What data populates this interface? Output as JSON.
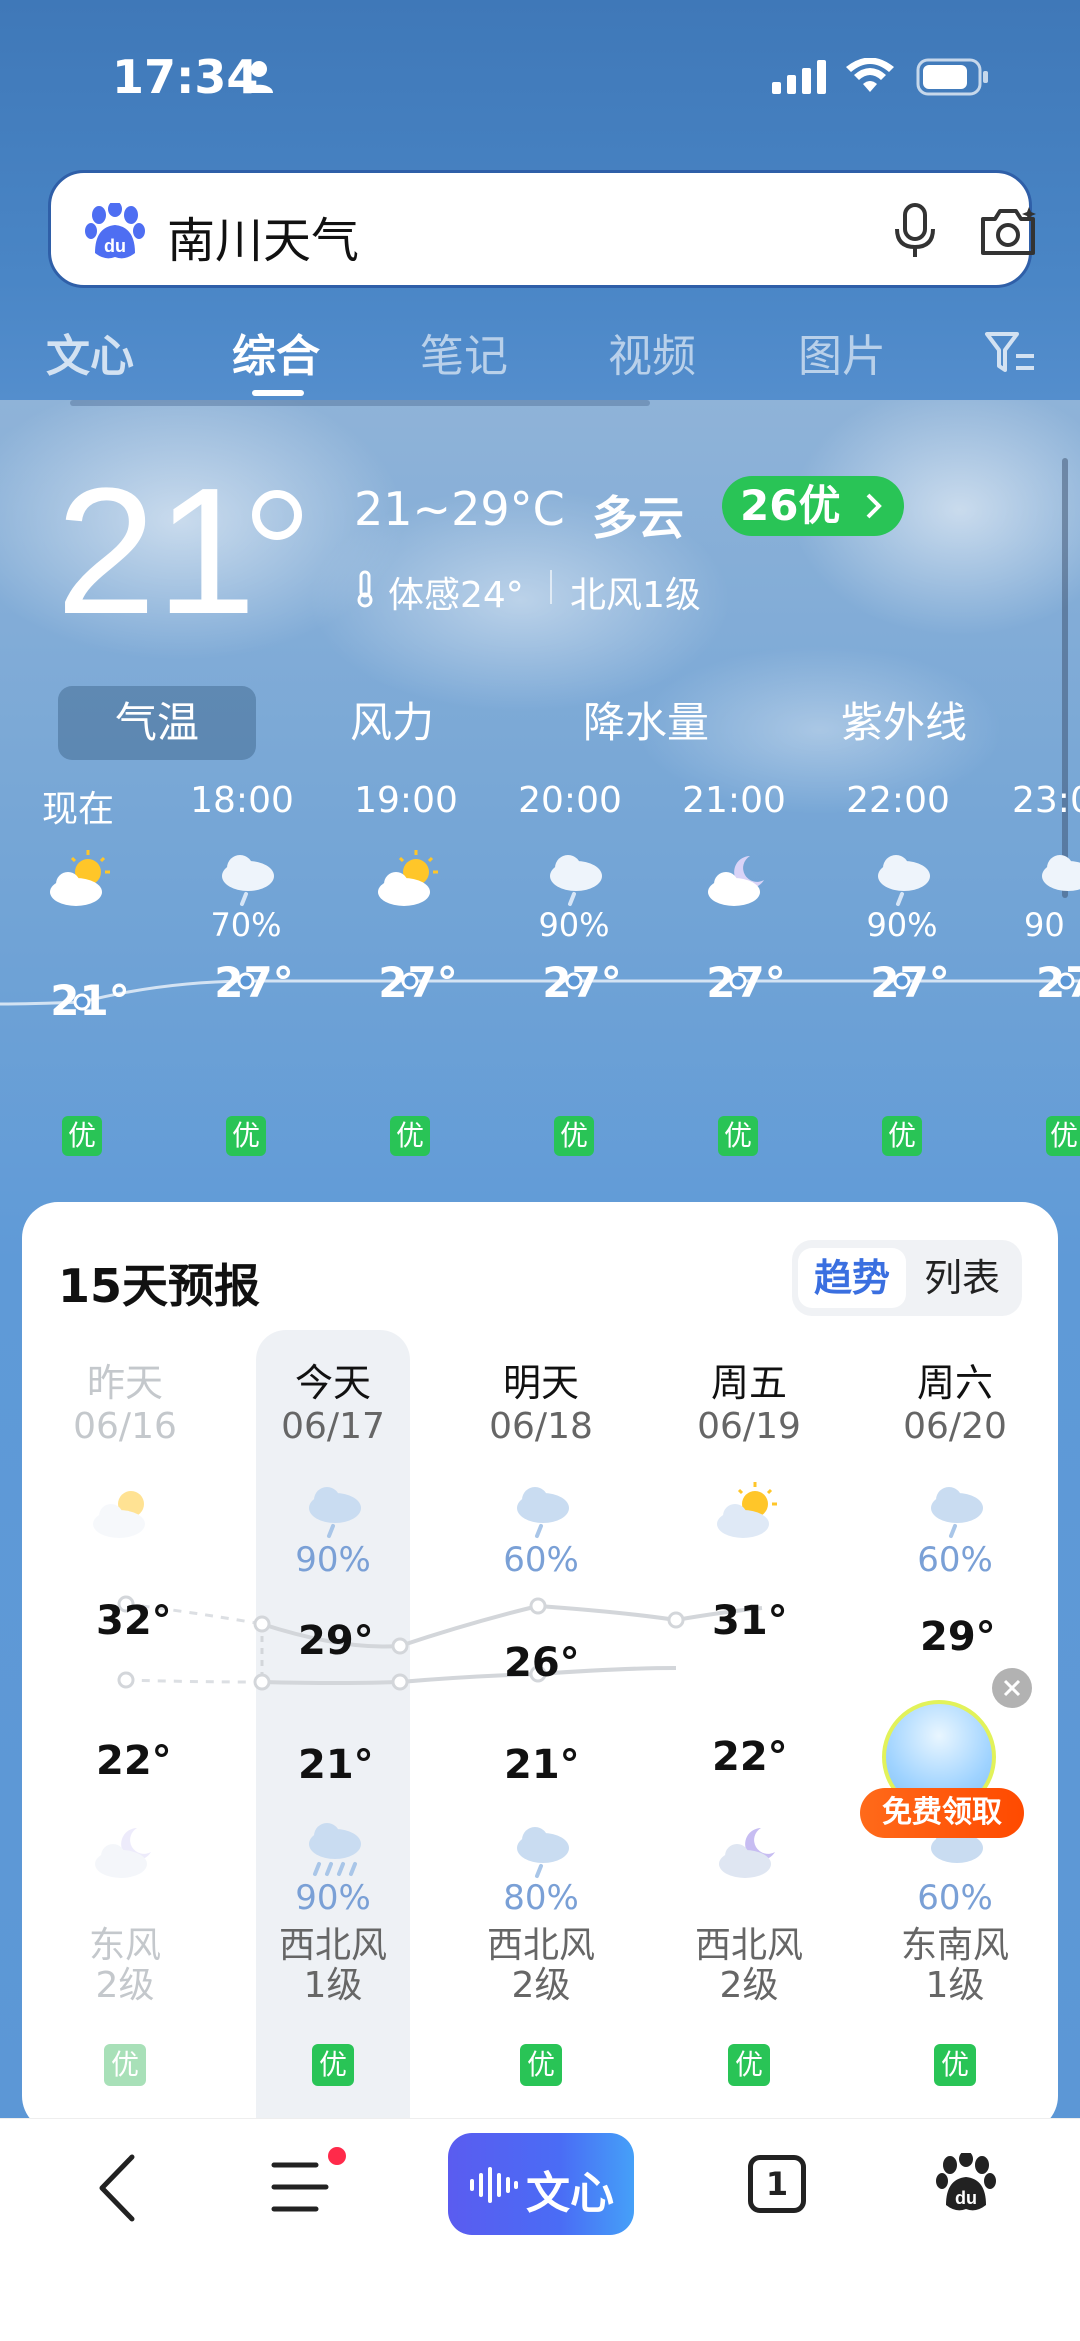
{
  "status_bar": {
    "time": "17:34"
  },
  "search": {
    "query": "南川天气"
  },
  "tabs": [
    {
      "label": "文心"
    },
    {
      "label": "综合"
    },
    {
      "label": "笔记"
    },
    {
      "label": "视频"
    },
    {
      "label": "图片"
    }
  ],
  "current": {
    "temp": "21",
    "range": "21~29°C",
    "condition": "多云",
    "aqi": "26优",
    "feels_like": "体感24°",
    "wind": "北风1级"
  },
  "segments": [
    {
      "label": "气温"
    },
    {
      "label": "风力"
    },
    {
      "label": "降水量"
    },
    {
      "label": "紫外线"
    }
  ],
  "hourly": [
    {
      "time": "现在",
      "icon": "partly-cloudy-sun-icon",
      "prob": "",
      "temp": "21°",
      "aqi": "优"
    },
    {
      "time": "18:00",
      "icon": "rain-cloud-icon",
      "prob": "70%",
      "temp": "27°",
      "aqi": "优"
    },
    {
      "time": "19:00",
      "icon": "partly-cloudy-sun-icon",
      "prob": "",
      "temp": "27°",
      "aqi": "优"
    },
    {
      "time": "20:00",
      "icon": "rain-cloud-icon",
      "prob": "90%",
      "temp": "27°",
      "aqi": "优"
    },
    {
      "time": "21:00",
      "icon": "cloudy-moon-icon",
      "prob": "",
      "temp": "27°",
      "aqi": "优"
    },
    {
      "time": "22:00",
      "icon": "rain-cloud-icon",
      "prob": "90%",
      "temp": "27°",
      "aqi": "优"
    },
    {
      "time": "23:0",
      "icon": "rain-cloud-icon",
      "prob": "90",
      "temp": "27",
      "aqi": "优"
    }
  ],
  "forecast": {
    "title": "15天预报",
    "toggle_active": "趋势",
    "toggle_other": "列表",
    "days": [
      {
        "name": "昨天",
        "date": "06/16",
        "icon_day": "partly-cloudy-sun-icon",
        "prob_day": "",
        "high": "32°",
        "low": "22°",
        "icon_night": "cloudy-moon-icon",
        "prob_night": "",
        "wind1": "东风",
        "wind2": "2级",
        "aqi": "优"
      },
      {
        "name": "今天",
        "date": "06/17",
        "icon_day": "rain-cloud-icon",
        "prob_day": "90%",
        "high": "29°",
        "low": "21°",
        "icon_night": "heavy-rain-icon",
        "prob_night": "90%",
        "wind1": "西北风",
        "wind2": "1级",
        "aqi": "优"
      },
      {
        "name": "明天",
        "date": "06/18",
        "icon_day": "rain-cloud-icon",
        "prob_day": "60%",
        "high": "26°",
        "low": "21°",
        "icon_night": "rain-cloud-icon",
        "prob_night": "80%",
        "wind1": "西北风",
        "wind2": "2级",
        "aqi": "优"
      },
      {
        "name": "周五",
        "date": "06/19",
        "icon_day": "partly-cloudy-sun-icon",
        "prob_day": "",
        "high": "31°",
        "low": "22°",
        "icon_night": "cloudy-moon-icon",
        "prob_night": "",
        "wind1": "西北风",
        "wind2": "2级",
        "aqi": "优"
      },
      {
        "name": "周六",
        "date": "06/20",
        "icon_day": "rain-cloud-icon",
        "prob_day": "60%",
        "high": "29°",
        "low": "",
        "icon_night": "rain-cloud-icon",
        "prob_night": "60%",
        "wind1": "东南风",
        "wind2": "1级",
        "aqi": "优"
      }
    ]
  },
  "promo": {
    "label": "免费领取"
  },
  "bottom_nav": {
    "wenxin_label": "文心",
    "tab_count": "1"
  },
  "colors": {
    "aqi_good": "#29c456",
    "accent": "#3a6fe0",
    "promo": "#ff5a0a"
  }
}
